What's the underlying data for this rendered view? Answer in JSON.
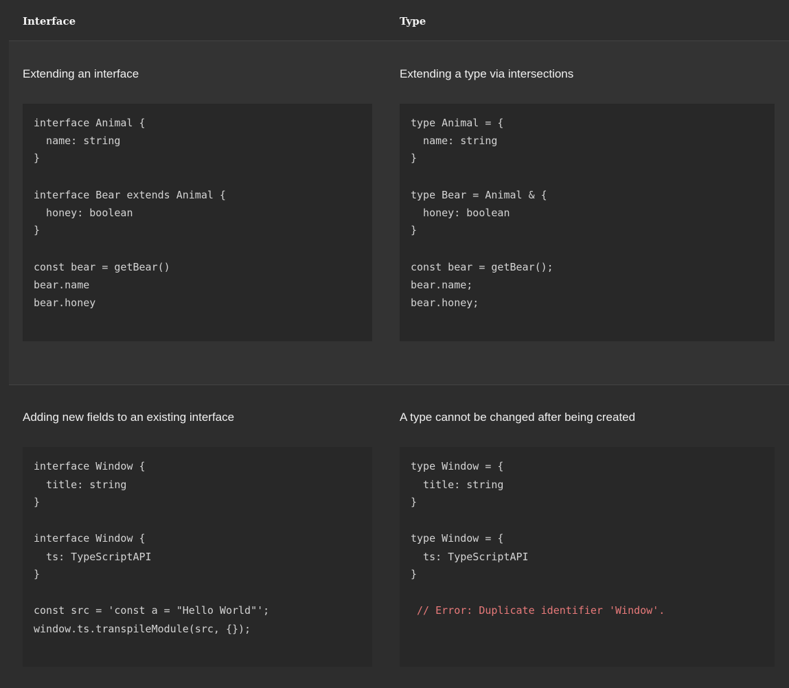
{
  "header": {
    "col1": "Interface",
    "col2": "Type"
  },
  "rows": [
    {
      "left": {
        "title": "Extending an interface",
        "code": [
          "interface Animal {",
          "  name: string",
          "}",
          "",
          "interface Bear extends Animal {",
          "  honey: boolean",
          "}",
          "",
          "const bear = getBear()",
          "bear.name",
          "bear.honey"
        ]
      },
      "right": {
        "title": "Extending a type via intersections",
        "code": [
          "type Animal = {",
          "  name: string",
          "}",
          "",
          "type Bear = Animal & {",
          "  honey: boolean",
          "}",
          "",
          "const bear = getBear();",
          "bear.name;",
          "bear.honey;"
        ]
      }
    },
    {
      "left": {
        "title": "Adding new fields to an existing interface",
        "code": [
          "interface Window {",
          "  title: string",
          "}",
          "",
          "interface Window {",
          "  ts: TypeScriptAPI",
          "}",
          "",
          "const src = 'const a = \"Hello World\"';",
          "window.ts.transpileModule(src, {});"
        ]
      },
      "right": {
        "title": "A type cannot be changed after being created",
        "code": [
          "type Window = {",
          "  title: string",
          "}",
          "",
          "type Window = {",
          "  ts: TypeScriptAPI",
          "}",
          "",
          " // Error: Duplicate identifier 'Window'."
        ]
      }
    }
  ],
  "colors": {
    "background": "#2d2d2d",
    "row_alt": "#333333",
    "code_bg": "#282828",
    "code_text": "#d4d4d4",
    "error_text": "#e87a7a"
  }
}
